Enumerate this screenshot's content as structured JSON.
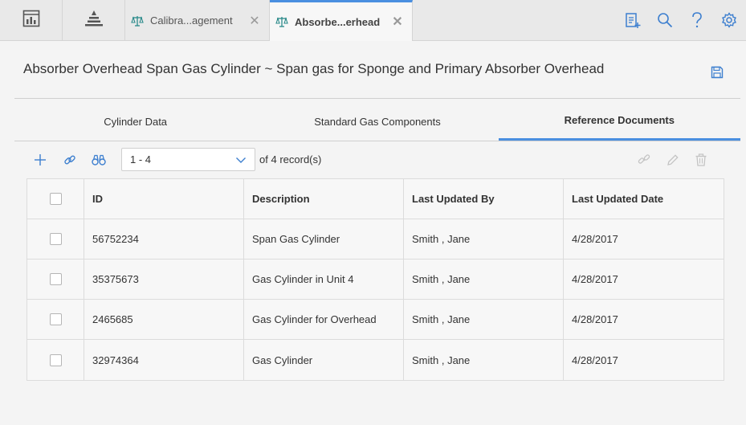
{
  "topbar": {
    "tabs": [
      {
        "label": "Calibra...agement",
        "active": false
      },
      {
        "label": "Absorbe...erhead",
        "active": true
      }
    ],
    "close_glyph": "✕",
    "icons": [
      "dashboard-icon",
      "hierarchy-icon",
      "new-document-icon",
      "search-icon",
      "help-icon",
      "settings-icon"
    ]
  },
  "page": {
    "title": "Absorber Overhead Span Gas Cylinder ~ Span gas for Sponge and Primary Absorber Overhead"
  },
  "subtabs": [
    {
      "label": "Cylinder Data",
      "active": false
    },
    {
      "label": "Standard Gas Components",
      "active": false
    },
    {
      "label": "Reference Documents",
      "active": true
    }
  ],
  "toolbar": {
    "pager_value": "1 - 4",
    "of_label": "of",
    "total": "4",
    "records_label": "record(s)"
  },
  "table": {
    "columns": [
      "ID",
      "Description",
      "Last Updated By",
      "Last Updated Date"
    ],
    "rows": [
      {
        "id": "56752234",
        "description": "Span Gas Cylinder",
        "updated_by": "Smith , Jane",
        "updated_date": "4/28/2017"
      },
      {
        "id": "35375673",
        "description": "Gas Cylinder in Unit 4",
        "updated_by": "Smith , Jane",
        "updated_date": "4/28/2017"
      },
      {
        "id": "2465685",
        "description": "Gas Cylinder for Overhead",
        "updated_by": "Smith , Jane",
        "updated_date": "4/28/2017"
      },
      {
        "id": "32974364",
        "description": "Gas Cylinder",
        "updated_by": "Smith , Jane",
        "updated_date": "4/28/2017"
      }
    ]
  },
  "colors": {
    "accent": "#4a8fe0",
    "icon": "#3d7fcf",
    "disabled": "#c4c4c4"
  }
}
